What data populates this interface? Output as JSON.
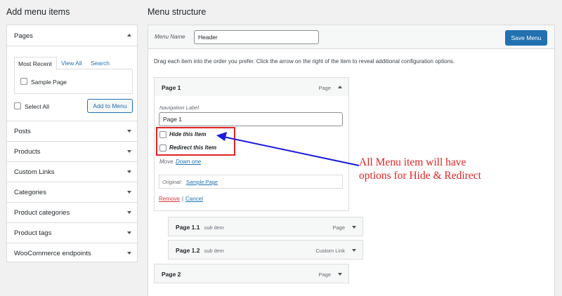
{
  "left": {
    "heading": "Add menu items",
    "pages": {
      "title": "Pages",
      "tabs": [
        "Most Recent",
        "View All",
        "Search"
      ],
      "sample_page": "Sample Page",
      "select_all": "Select All",
      "add_button": "Add to Menu"
    },
    "accordion": [
      "Posts",
      "Products",
      "Custom Links",
      "Categories",
      "Product categories",
      "Product tags",
      "WooCommerce endpoints"
    ]
  },
  "right": {
    "heading": "Menu structure",
    "menu_name_label": "Menu Name",
    "menu_name_value": "Header",
    "save_button": "Save Menu",
    "instructions": "Drag each item into the order you prefer. Click the arrow on the right of the item to reveal additional configuration options."
  },
  "items": [
    {
      "title": "Page 1",
      "sub": "",
      "type": "Page"
    },
    {
      "title": "Page 1.1",
      "sub": "sub item",
      "type": "Page"
    },
    {
      "title": "Page 1.2",
      "sub": "sub item",
      "type": "Custom Link"
    },
    {
      "title": "Page 2",
      "sub": "",
      "type": "Page"
    }
  ],
  "settings": {
    "nav_label_label": "Navigation Label",
    "nav_label_value": "Page 1",
    "hide_item": "Hide this Item",
    "redirect_item": "Redirect this Item",
    "move_label": "Move",
    "move_link": "Down one",
    "original_label": "Original:",
    "original_link": "Sample Page",
    "remove": "Remove",
    "separator": "|",
    "cancel": "Cancel"
  },
  "annotation": {
    "line1": "All Menu item will have",
    "line2": "options for Hide & Redirect",
    "color": "#e02424",
    "arrow_color": "#1a1adc"
  },
  "colors": {
    "accent": "#2271b1",
    "danger": "#d63638",
    "background": "#f1f1f1"
  }
}
